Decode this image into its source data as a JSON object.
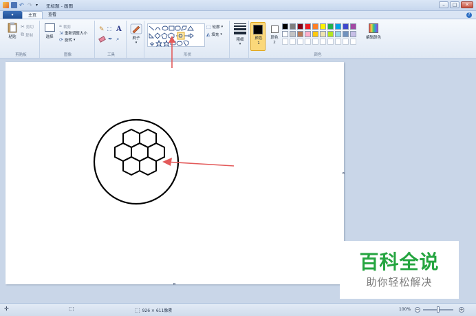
{
  "titlebar": {
    "title": "无标题 - 画图",
    "minimize": "–",
    "maximize": "□",
    "close": "✕"
  },
  "tabs": {
    "app_menu": "▾",
    "items": [
      {
        "label": "主页",
        "active": true
      },
      {
        "label": "查看",
        "active": false
      }
    ],
    "help": "?"
  },
  "ribbon": {
    "clipboard": {
      "paste": "粘贴",
      "cut": "剪切",
      "copy": "复制",
      "label": "剪贴板"
    },
    "image": {
      "select": "选择",
      "crop": "裁剪",
      "resize": "重新调整大小",
      "rotate": "旋转",
      "label": "图像"
    },
    "tools": {
      "text_tool": "A",
      "label": "工具"
    },
    "brushes": {
      "label": "刷子"
    },
    "shapes": {
      "outline": "轮廓",
      "fill": "填充",
      "label": "形状"
    },
    "size": {
      "label": "粗细"
    },
    "colors": {
      "color1": "颜色 1",
      "color2": "颜色 2",
      "edit": "编辑颜色",
      "label": "颜色",
      "color1_value": "#000000",
      "color2_value": "#ffffff",
      "palette": [
        "#000000",
        "#7f7f7f",
        "#880015",
        "#ed1c24",
        "#ff7f27",
        "#fff200",
        "#22b14c",
        "#00a2e8",
        "#3f48cc",
        "#a349a4",
        "#ffffff",
        "#c3c3c3",
        "#b97a57",
        "#ffaec9",
        "#ffc90e",
        "#efe4b0",
        "#b5e61d",
        "#99d9ea",
        "#7092be",
        "#c8bfe7"
      ]
    }
  },
  "statusbar": {
    "canvas_size": "926 × 611像素",
    "zoom": "100%",
    "zoom_out": "−",
    "zoom_in": "+"
  },
  "watermark": {
    "main": "百科全说",
    "sub": "助你轻松解决"
  }
}
